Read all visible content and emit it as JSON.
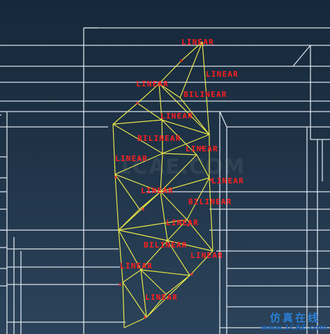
{
  "viewport": {
    "background": "#1f3347",
    "wire_color": "#d9e2ea",
    "mesh_color": "#e8e64a",
    "node_color": "#ff2a2a",
    "label_color": "#ff1f1f"
  },
  "labels": [
    "LINEAR",
    "LINEAR",
    "LINEAR",
    "BILINEAR",
    "LINEAR",
    "BILINEAR",
    "LINEAR",
    "LINEAR",
    "LINEAR",
    "LINEAR",
    "BILINEAR",
    "LINEAR",
    "BILINEAR",
    "LINEAR",
    "LINEAR",
    "LINEAR"
  ],
  "watermark": "1CAE.COM",
  "logo": {
    "text_cn": "仿真在线",
    "url": "www.1CAE.com",
    "color_cn": "#2a7fd6",
    "color_url": "#1a5fb0"
  }
}
